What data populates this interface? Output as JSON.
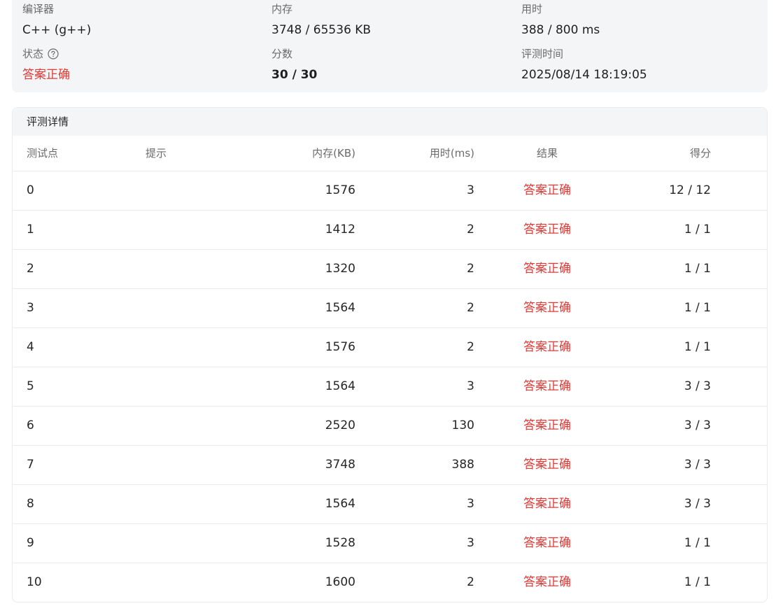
{
  "summary": {
    "compiler_label": "编译器",
    "compiler_value": "C++ (g++)",
    "memory_label": "内存",
    "memory_value": "3748 / 65536 KB",
    "time_label": "用时",
    "time_value": "388 / 800 ms",
    "status_label": "状态",
    "status_value": "答案正确",
    "score_label": "分数",
    "score_value": "30 / 30",
    "judge_time_label": "评测时间",
    "judge_time_value": "2025/08/14 18:19:05"
  },
  "details": {
    "title": "评测详情",
    "columns": {
      "id": "测试点",
      "hint": "提示",
      "memory": "内存(KB)",
      "time": "用时(ms)",
      "result": "结果",
      "score": "得分"
    },
    "rows": [
      {
        "id": "0",
        "hint": "",
        "memory": "1576",
        "time": "3",
        "result": "答案正确",
        "score": "12 / 12"
      },
      {
        "id": "1",
        "hint": "",
        "memory": "1412",
        "time": "2",
        "result": "答案正确",
        "score": "1 / 1"
      },
      {
        "id": "2",
        "hint": "",
        "memory": "1320",
        "time": "2",
        "result": "答案正确",
        "score": "1 / 1"
      },
      {
        "id": "3",
        "hint": "",
        "memory": "1564",
        "time": "2",
        "result": "答案正确",
        "score": "1 / 1"
      },
      {
        "id": "4",
        "hint": "",
        "memory": "1576",
        "time": "2",
        "result": "答案正确",
        "score": "1 / 1"
      },
      {
        "id": "5",
        "hint": "",
        "memory": "1564",
        "time": "3",
        "result": "答案正确",
        "score": "3 / 3"
      },
      {
        "id": "6",
        "hint": "",
        "memory": "2520",
        "time": "130",
        "result": "答案正确",
        "score": "3 / 3"
      },
      {
        "id": "7",
        "hint": "",
        "memory": "3748",
        "time": "388",
        "result": "答案正确",
        "score": "3 / 3"
      },
      {
        "id": "8",
        "hint": "",
        "memory": "1564",
        "time": "3",
        "result": "答案正确",
        "score": "3 / 3"
      },
      {
        "id": "9",
        "hint": "",
        "memory": "1528",
        "time": "3",
        "result": "答案正确",
        "score": "1 / 1"
      },
      {
        "id": "10",
        "hint": "",
        "memory": "1600",
        "time": "2",
        "result": "答案正确",
        "score": "1 / 1"
      }
    ]
  },
  "colors": {
    "accepted": "#e53935",
    "panel_bg": "#f4f5f7"
  },
  "icons": {
    "status_help": "question-circle-icon"
  }
}
